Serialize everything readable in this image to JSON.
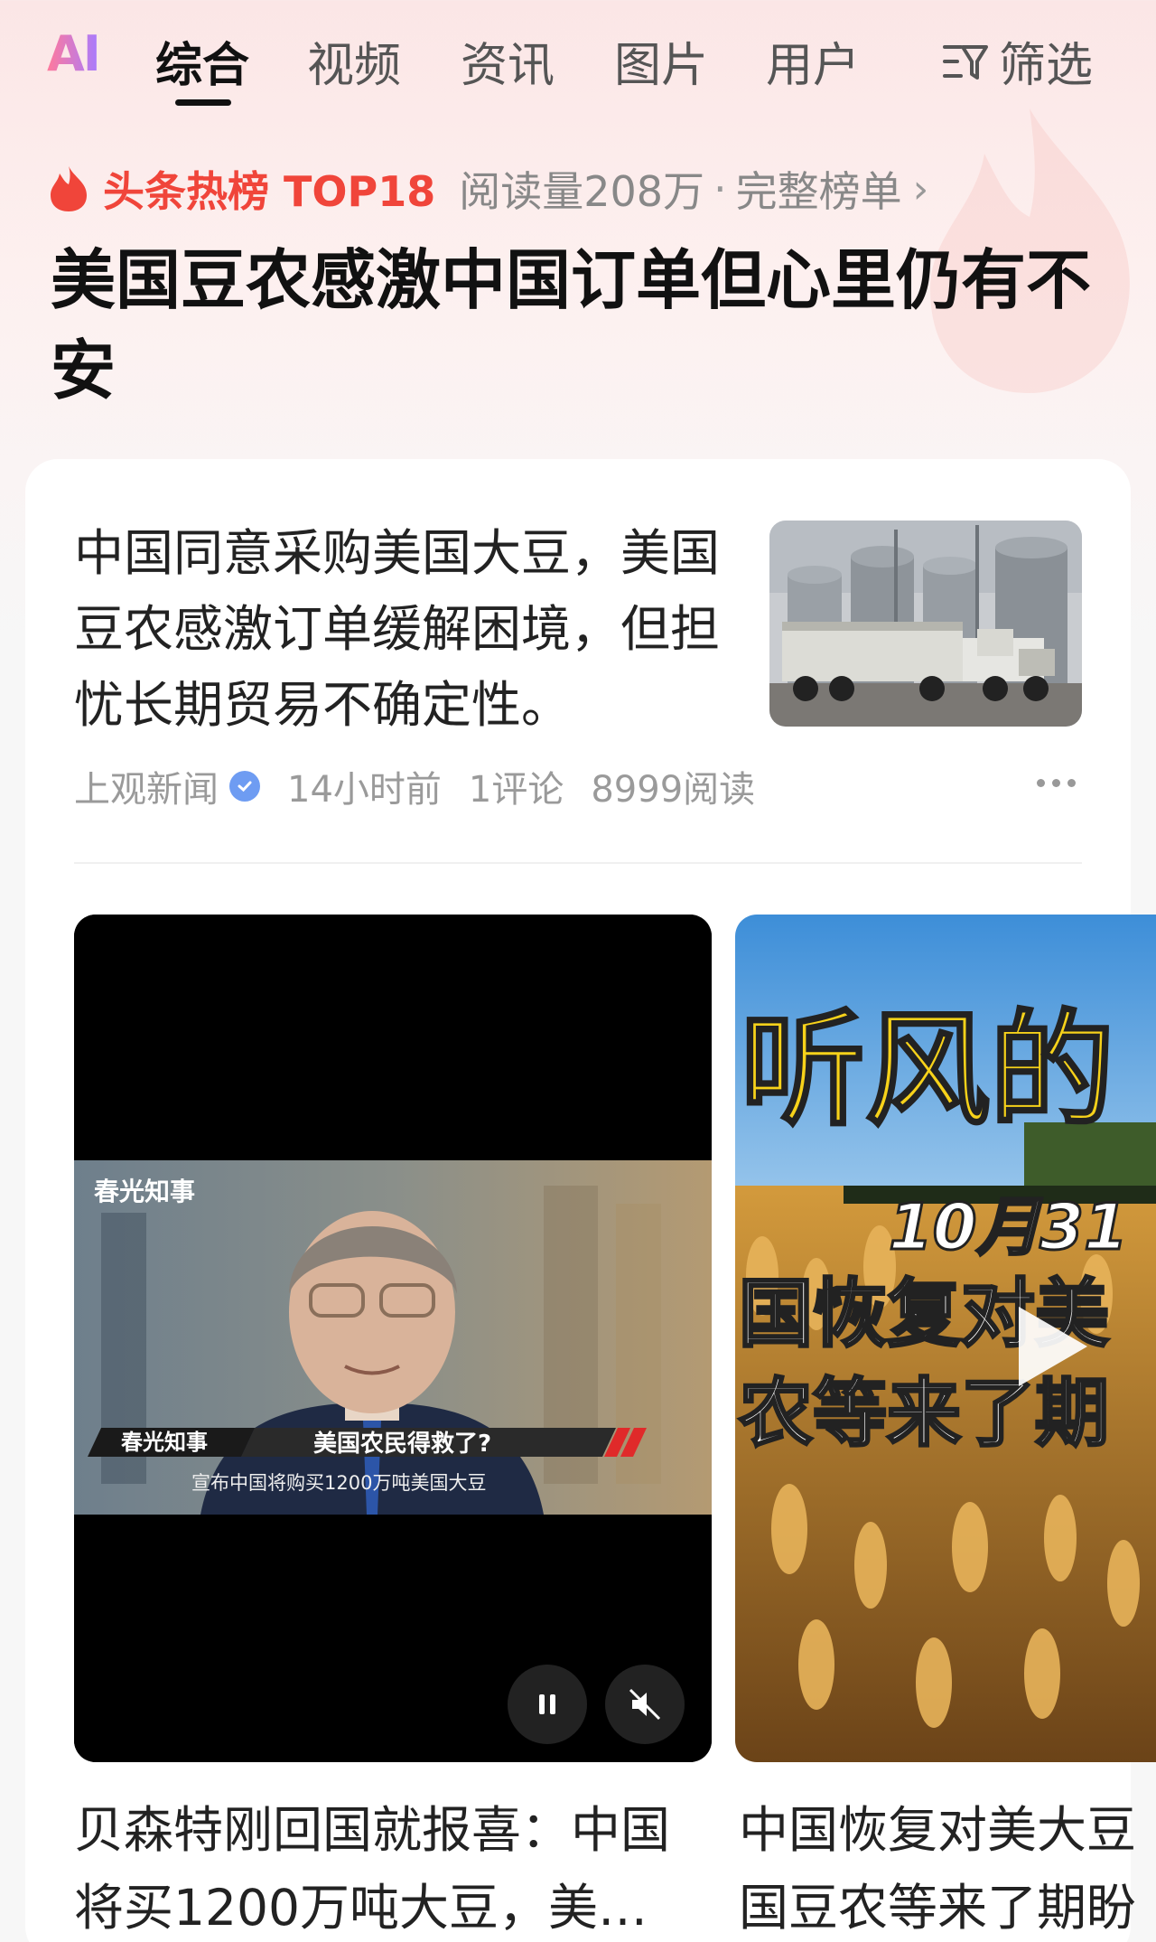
{
  "tabs": {
    "ai_label": "AI",
    "items": [
      {
        "label": "综合"
      },
      {
        "label": "视频"
      },
      {
        "label": "资讯"
      },
      {
        "label": "图片"
      },
      {
        "label": "用户"
      }
    ],
    "filter_label": "筛选"
  },
  "hotlist": {
    "rank": "头条热榜 TOP18",
    "reads": "阅读量208万",
    "separator": "·",
    "full_list": "完整榜单",
    "chevron": "›"
  },
  "headline": "美国豆农感激中国订单但心里仍有不安",
  "article": {
    "summary": "中国同意采购美国大豆，美国豆农感激订单缓解困境，但担忧长期贸易不确定性。",
    "source": "上观新闻",
    "time": "14小时前",
    "comments": "1评论",
    "reads": "8999阅读"
  },
  "video1": {
    "logo": "春光知事",
    "lower_logo": "春光知事",
    "lower_title": "美国农民得救了?",
    "subtitle": "宣布中国将购买1200万吨美国大豆",
    "title": "贝森特刚回国就报喜：中国将买1200万吨大豆，美…"
  },
  "video2": {
    "overlay_big": "听风的",
    "overlay_date": "10月31",
    "overlay_line1": "国恢复对美",
    "overlay_line2": "农等来了期",
    "title": "中国恢复对美大豆国豆农等来了期盼"
  },
  "colors": {
    "accent_red": "#f0453a",
    "verified_blue": "#6e9cf2",
    "overlay_yellow": "#f7d21a"
  }
}
